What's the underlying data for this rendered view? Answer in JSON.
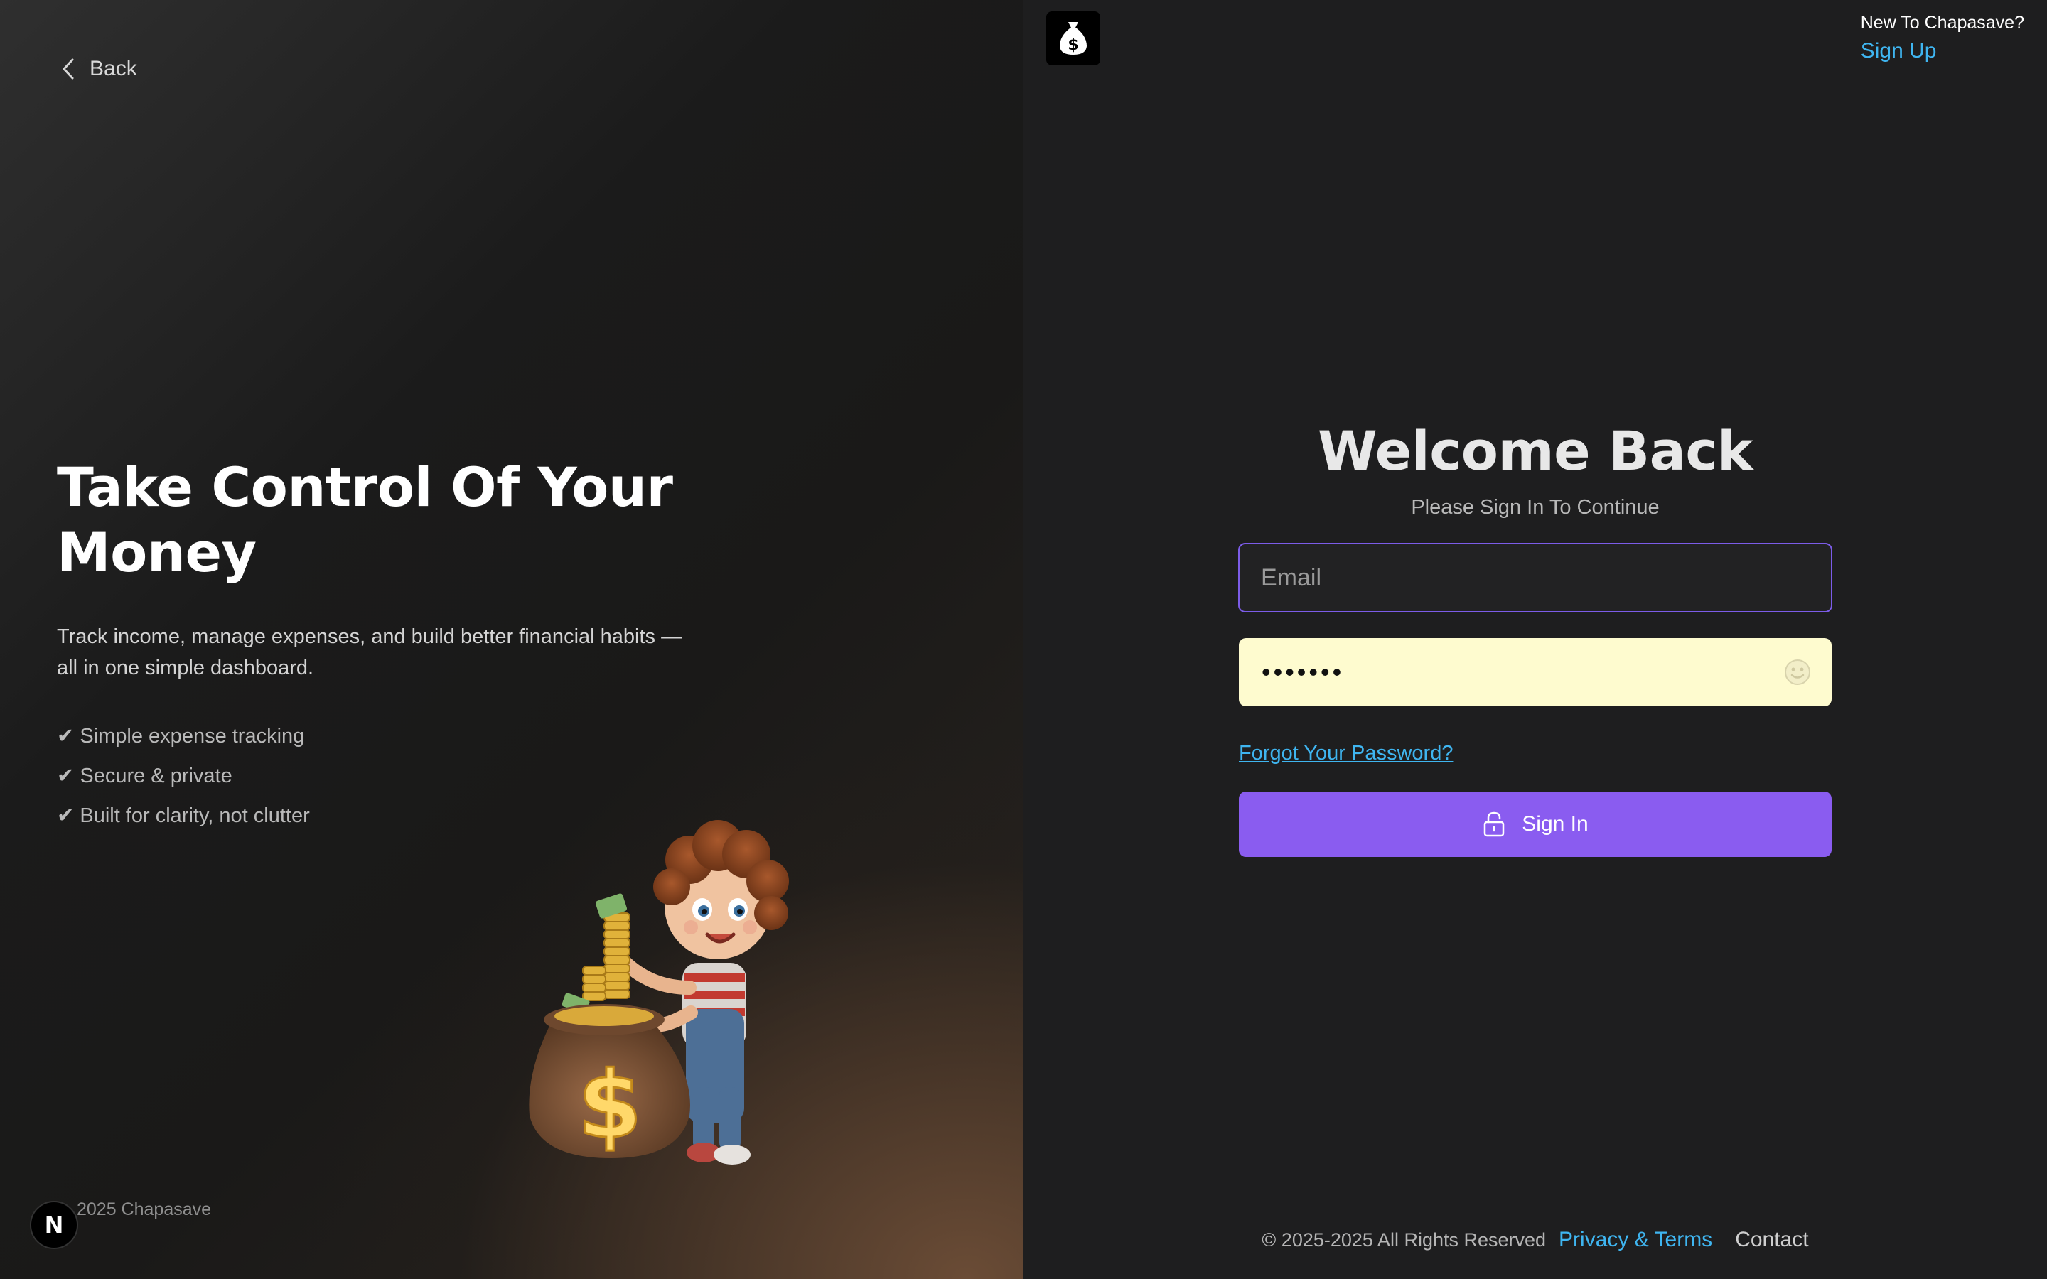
{
  "left": {
    "back_label": "Back",
    "headline": "Take Control Of Your Money",
    "description": "Track income, manage expenses, and build better financial habits — all in one simple dashboard.",
    "features": [
      "✔ Simple expense tracking",
      "✔ Secure & private",
      "✔ Built for clarity, not clutter"
    ],
    "copyright": "2025 Chapasave",
    "next_badge": "N"
  },
  "right": {
    "signup_prompt": "New To Chapasave?",
    "signup_link": "Sign Up",
    "title": "Welcome Back",
    "subtitle": "Please Sign In To Continue",
    "email_placeholder": "Email",
    "email_value": "",
    "password_value": "•••••••",
    "forgot_link": "Forgot Your Password?",
    "signin_label": "Sign In",
    "footer": {
      "copyright": "© 2025-2025 All Rights Reserved",
      "privacy": "Privacy & Terms",
      "contact": "Contact"
    }
  },
  "colors": {
    "accent": "#8a5cf0",
    "link": "#3fb5f0",
    "focus_border": "#7c5ce8",
    "autofill_bg": "#fefbcf"
  },
  "icons": {
    "back": "chevron-left-icon",
    "logo": "money-bag-icon",
    "password_toggle": "smiley-icon",
    "signin": "lock-icon"
  }
}
